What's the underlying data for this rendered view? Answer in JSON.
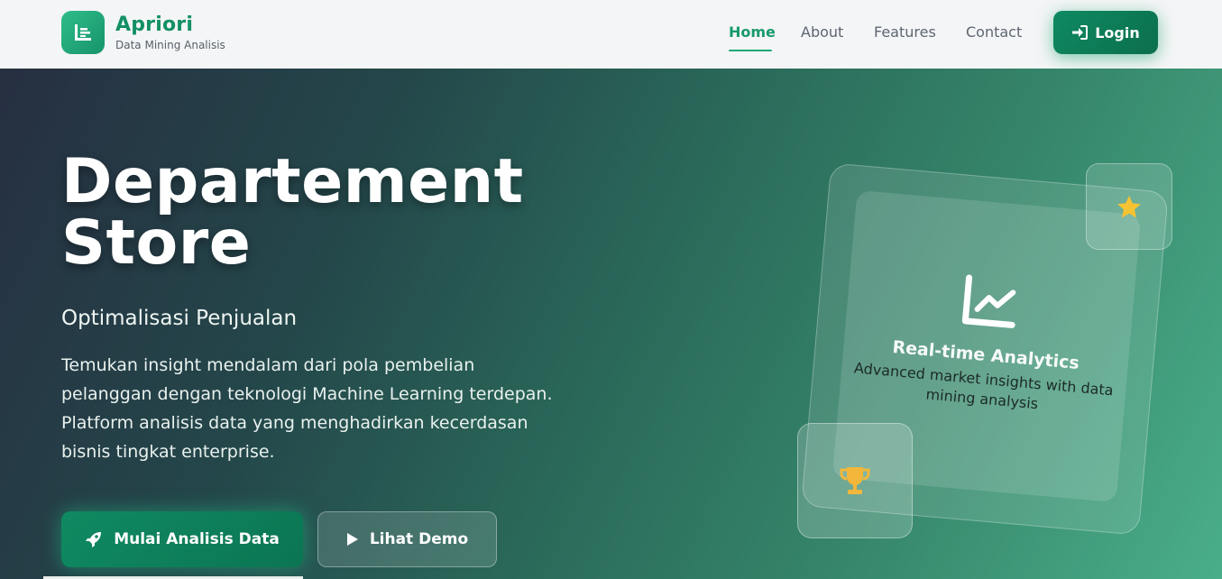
{
  "brand": {
    "title": "Apriori",
    "subtitle": "Data Mining Analisis",
    "logo_icon": "chart-bar-icon"
  },
  "nav": {
    "items": [
      {
        "label": "Home",
        "active": true
      },
      {
        "label": "About",
        "active": false
      },
      {
        "label": "Features",
        "active": false
      },
      {
        "label": "Contact",
        "active": false
      }
    ],
    "login_label": "Login",
    "login_icon": "sign-in-icon"
  },
  "hero": {
    "title_line1": "Departement",
    "title_line2": "Store",
    "subtitle": "Optimalisasi Penjualan",
    "description_line1": "Temukan insight mendalam dari pola pembelian",
    "description_line2": "pelanggan dengan teknologi Machine Learning terdepan.",
    "description_line3": "Platform analisis data yang menghadirkan kecerdasan",
    "description_line4": "bisnis tingkat enterprise.",
    "primary_button": "Mulai Analisis Data",
    "primary_icon": "rocket-icon",
    "secondary_button": "Lihat Demo",
    "secondary_icon": "play-icon"
  },
  "card": {
    "icon": "chart-line-icon",
    "title": "Real-time Analytics",
    "description": "Advanced market insights with data mining analysis",
    "star_icon": "star-icon",
    "trophy_icon": "trophy-icon"
  },
  "colors": {
    "brand_green": "#139064",
    "accent_green": "#179a6c",
    "button_green": "#0f8a62",
    "star_yellow": "#f6c333",
    "trophy_yellow": "#f2b73a"
  }
}
